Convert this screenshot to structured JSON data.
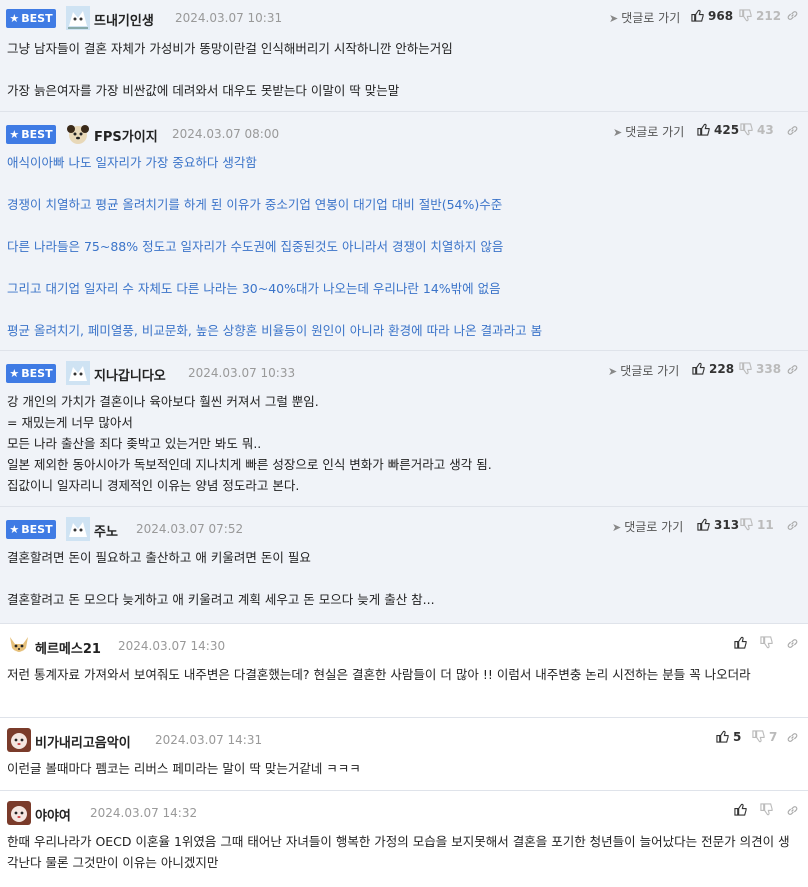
{
  "colors": {
    "best_badge": "#3f7be4",
    "best_bg": "#f0f3f8",
    "blue_text": "#3b74c9"
  },
  "labels": {
    "best": "BEST",
    "goto": "댓글로 가기"
  },
  "comments": [
    {
      "nick": "뜨내기인생",
      "date": "2024.03.07 10:31",
      "likes": "968",
      "dislikes": "212",
      "lines": [
        "그냥 남자들이 결혼 자체가 가성비가 똥망이란걸 인식해버리기 시작하니깐 안하는거임",
        "",
        "가장 늙은여자를 가장 비싼값에 데려와서 대우도 못받는다 이말이 딱 맞는말"
      ]
    },
    {
      "nick": "FPS가이지",
      "date": "2024.03.07 08:00",
      "likes": "425",
      "dislikes": "43",
      "lines": [
        "애식이아빠 나도 일자리가 가장 중요하다 생각함",
        "",
        "경쟁이 치열하고 평균 올려치기를 하게 된 이유가 중소기업 연봉이 대기업 대비 절반(54%)수준",
        "",
        "다른 나라들은 75~88% 정도고 일자리가 수도권에 집중된것도 아니라서 경쟁이 치열하지 않음",
        "",
        "그리고 대기업 일자리 수 자체도 다른 나라는 30~40%대가 나오는데 우리나란 14%밖에 없음",
        "",
        "평균 올려치기, 페미열풍, 비교문화, 높은 상향혼 비율등이 원인이 아니라 환경에 따라 나온 결과라고 봄"
      ]
    },
    {
      "nick": "지나갑니다오",
      "date": "2024.03.07 10:33",
      "likes": "228",
      "dislikes": "338",
      "lines": [
        "강 개인의 가치가 결혼이나 육아보다 훨씬 커져서 그럴 뿐임.",
        "= 재밌는게 너무 많아서",
        "모든 나라 출산을 죄다 좆박고 있는거만 봐도 뭐..",
        "일본 제외한 동아시아가 독보적인데 지나치게 빠른 성장으로 인식 변화가 빠른거라고 생각 됨.",
        "집값이니 일자리니 경제적인 이유는 양념 정도라고 본다."
      ]
    },
    {
      "nick": "주노",
      "date": "2024.03.07 07:52",
      "likes": "313",
      "dislikes": "11",
      "lines": [
        "결혼할려면 돈이 필요하고 출산하고 애 키울려면 돈이 필요",
        "",
        "결혼할려고 돈 모으다 늦게하고 애 키울려고 계획 세우고 돈 모으다 늦게 출산 참..."
      ]
    },
    {
      "nick": "헤르메스21",
      "date": "2024.03.07 14:30",
      "likes": "",
      "dislikes": "",
      "lines": [
        "저런 통계자료 가져와서 보여줘도 내주변은 다결혼했는데? 현실은 결혼한 사람들이 더 많아 !! 이럼서 내주변충 논리 시전하는 분들 꼭 나오더라"
      ]
    },
    {
      "nick": "비가내리고음악이",
      "date": "2024.03.07 14:31",
      "likes": "5",
      "dislikes": "7",
      "lines": [
        "이런글 볼때마다 펨코는 리버스 페미라는 말이 딱 맞는거같네 ㅋㅋㅋ"
      ]
    },
    {
      "nick": "야야여",
      "date": "2024.03.07 14:32",
      "likes": "",
      "dislikes": "",
      "lines": [
        "한때 우리나라가 OECD 이혼율 1위였음 그때 태어난 자녀들이 행복한 가정의 모습을 보지못해서 결혼을 포기한 청년들이 늘어났다는 전문가 의견이 생각난다 물론 그것만이 이유는 아니겠지만"
      ]
    }
  ]
}
